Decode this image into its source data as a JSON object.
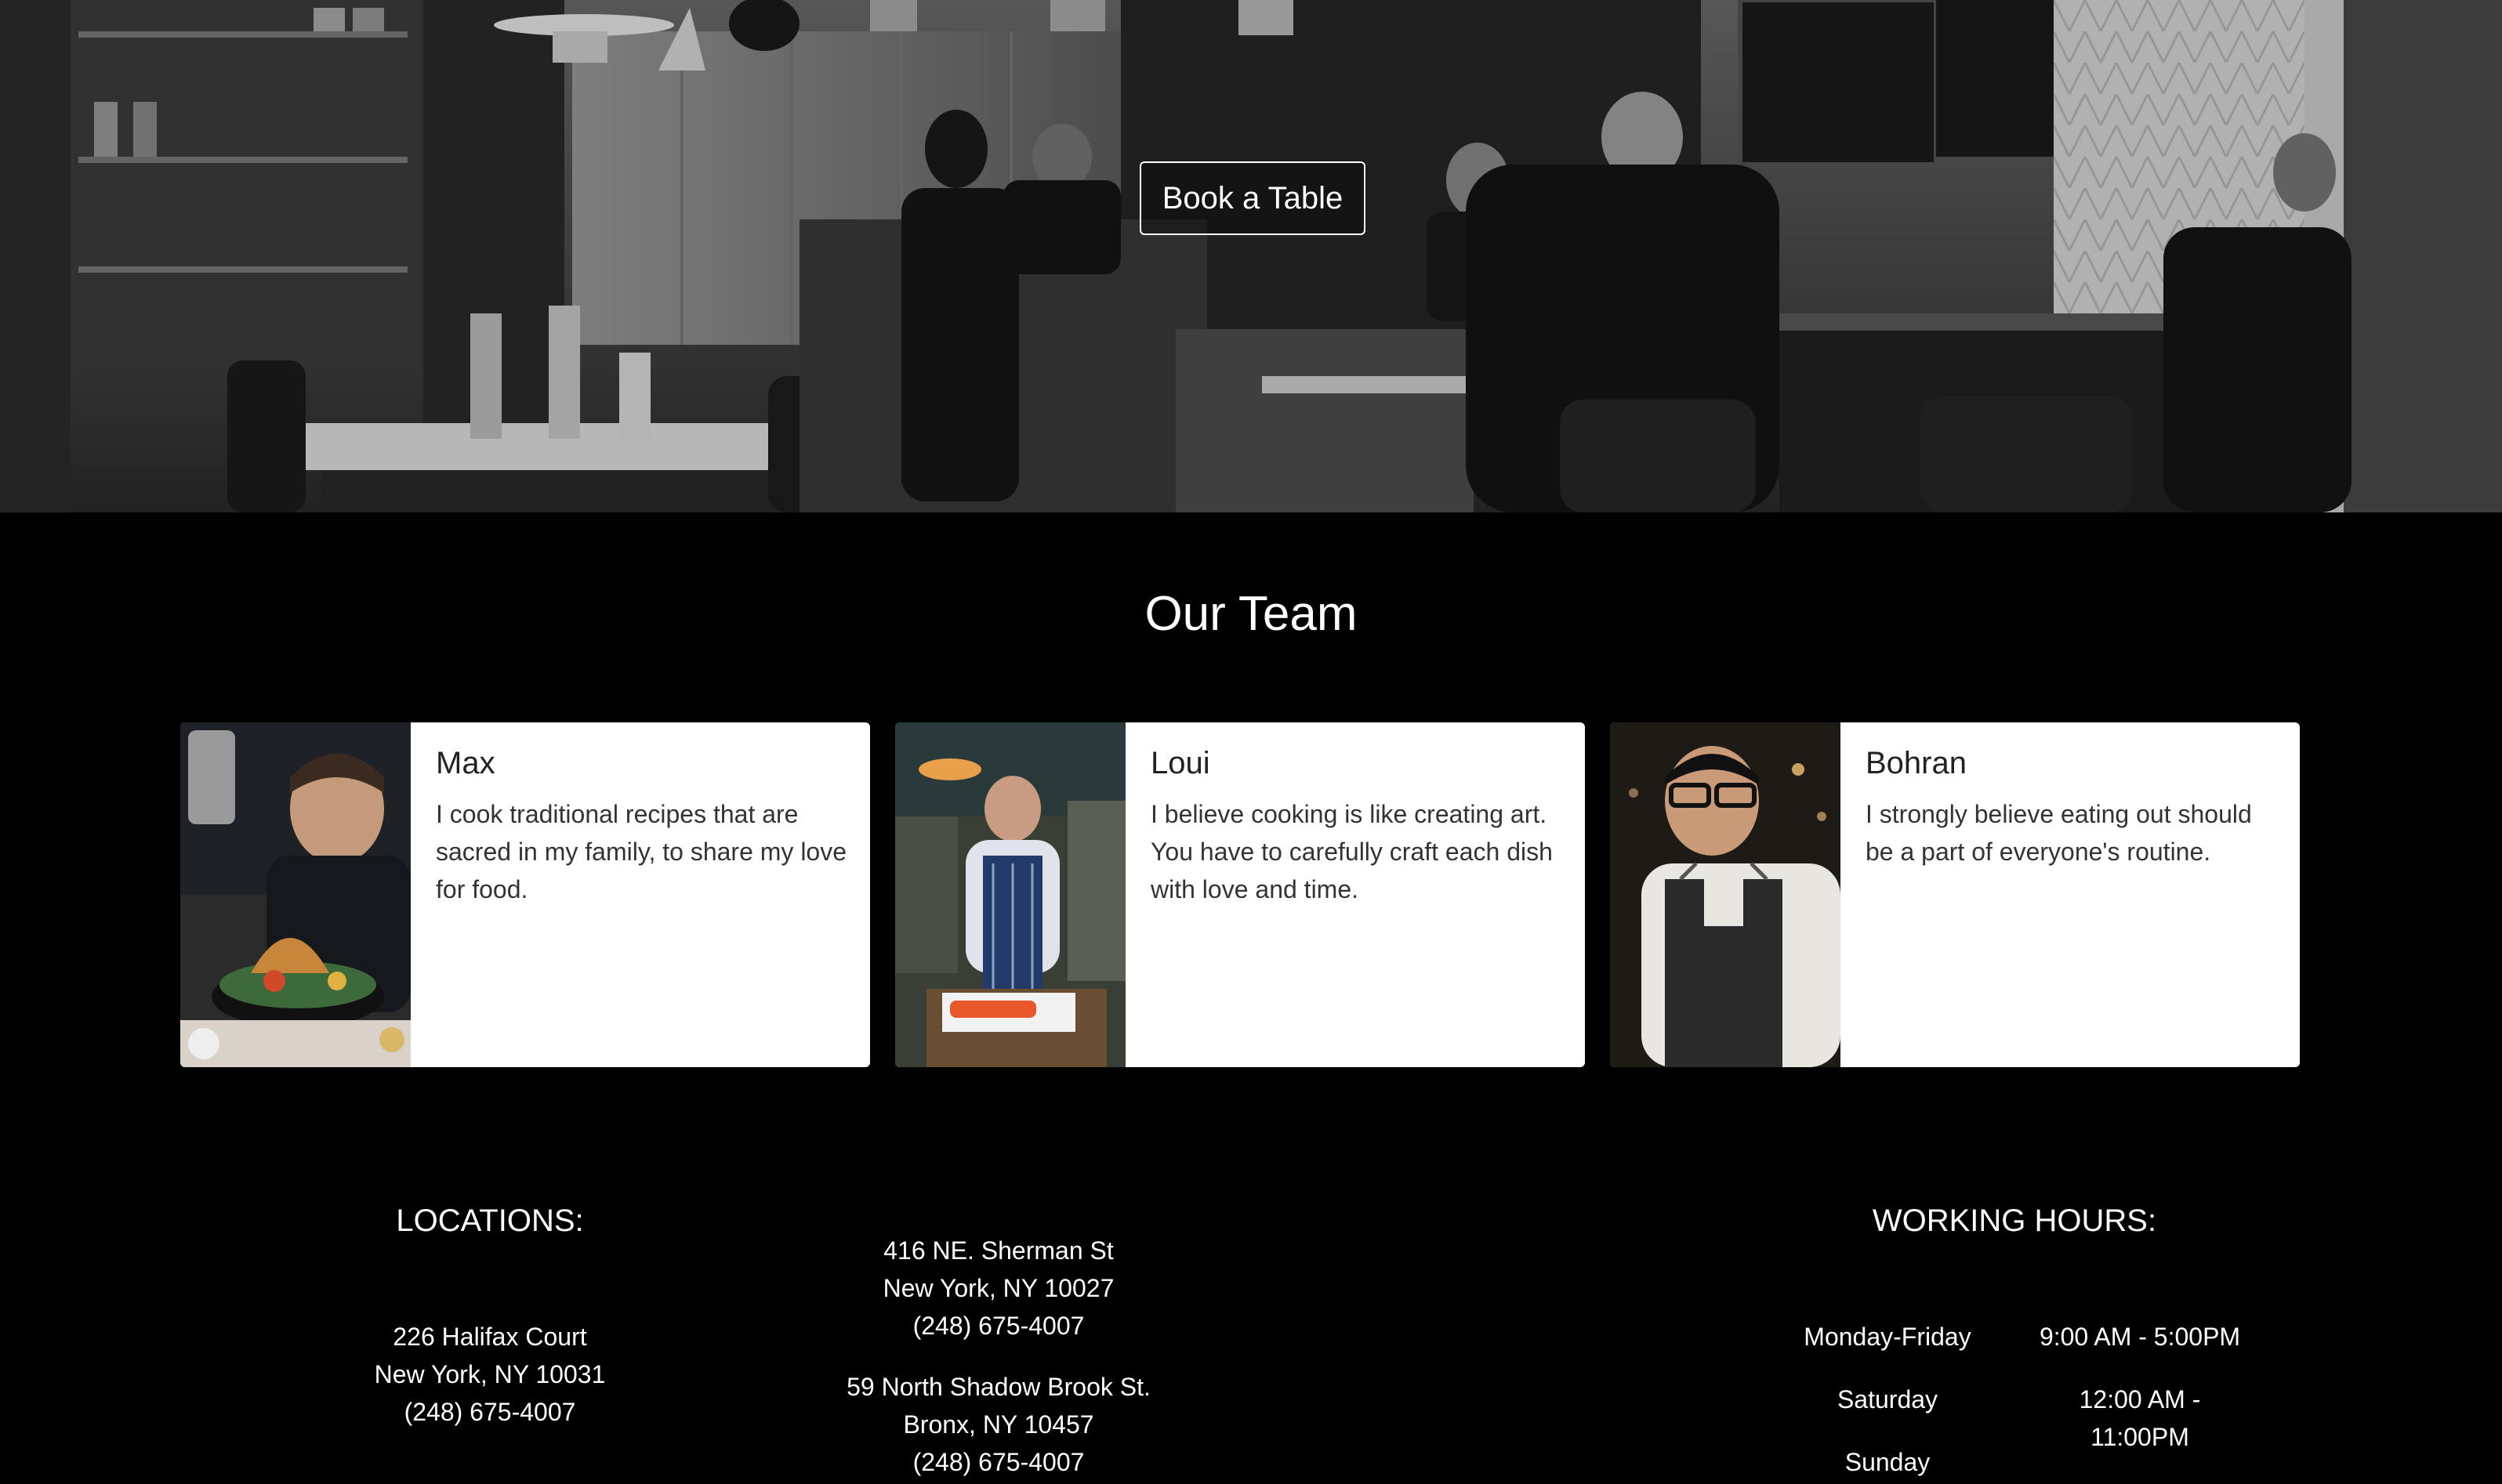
{
  "hero": {
    "book_button": "Book a Table"
  },
  "team": {
    "title": "Our Team",
    "members": [
      {
        "name": "Max",
        "description": "I cook traditional recipes that are sacred in my family, to share my love for food."
      },
      {
        "name": "Loui",
        "description": "I believe cooking is like creating art. You have to carefully craft each dish with love and time."
      },
      {
        "name": "Bohran",
        "description": "I strongly believe eating out should be a part of everyone's routine."
      }
    ]
  },
  "footer": {
    "locations_title": "LOCATIONS:",
    "locations": [
      {
        "street": "226 Halifax Court",
        "city": "New York, NY 10031",
        "phone": "(248) 675-4007"
      },
      {
        "street": "416 NE. Sherman St",
        "city": "New York, NY 10027",
        "phone": "(248) 675-4007"
      },
      {
        "street": "59 North Shadow Brook St.",
        "city": "Bronx, NY 10457",
        "phone": "(248) 675-4007"
      }
    ],
    "hours_title": "WORKING HOURS:",
    "hours": [
      {
        "day": "Monday-Friday",
        "time": "9:00 AM - 5:00PM"
      },
      {
        "day": "Saturday",
        "time_line1": "12:00 AM -",
        "time_line2": "11:00PM"
      },
      {
        "day": "Sunday"
      }
    ]
  },
  "colors": {
    "background": "#000000",
    "card_background": "#ffffff",
    "text_light": "#ffffff",
    "text_dark": "#222222"
  }
}
